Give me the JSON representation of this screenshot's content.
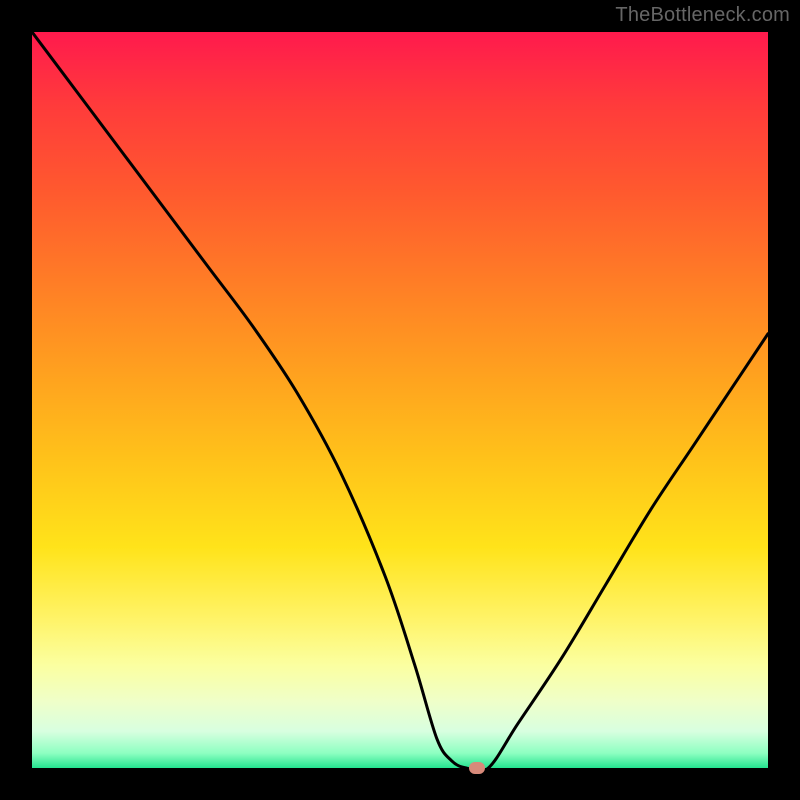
{
  "watermark": "TheBottleneck.com",
  "chart_data": {
    "type": "line",
    "title": "",
    "xlabel": "",
    "ylabel": "",
    "xlim": [
      0,
      100
    ],
    "ylim": [
      0,
      100
    ],
    "x": [
      0,
      6,
      12,
      18,
      24,
      30,
      36,
      42,
      48,
      52,
      55,
      57,
      59,
      62,
      66,
      72,
      78,
      84,
      90,
      96,
      100
    ],
    "y": [
      100,
      92,
      84,
      76,
      68,
      60,
      51,
      40,
      26,
      14,
      4,
      1,
      0,
      0,
      6,
      15,
      25,
      35,
      44,
      53,
      59
    ],
    "marker": {
      "x": 60.5,
      "y": 0
    },
    "legend": false,
    "grid": false
  },
  "colors": {
    "frame": "#000000",
    "curve": "#000000",
    "marker": "#d88a7a",
    "watermark": "#666666"
  }
}
